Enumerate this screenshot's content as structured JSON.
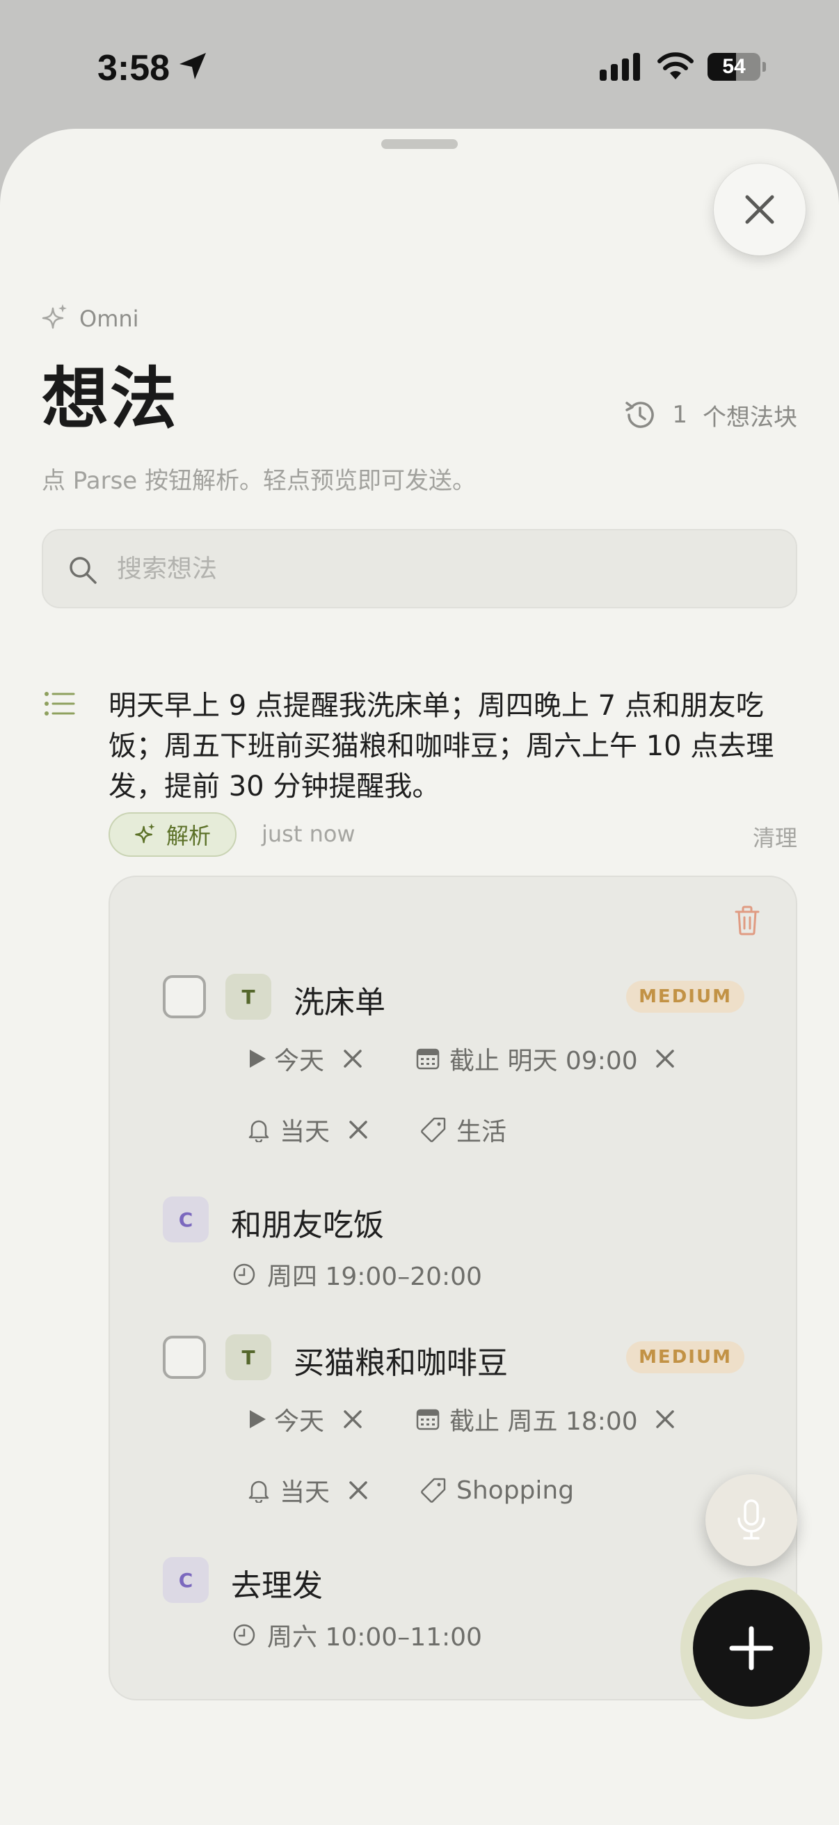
{
  "status_bar": {
    "time": "3:58",
    "battery": "54"
  },
  "header": {
    "app_label": "Omni",
    "title": "想法",
    "blocks_count": "1",
    "blocks_label": "个想法块",
    "hint": "点 Parse 按钮解析。轻点预览即可发送。"
  },
  "search": {
    "placeholder": "搜索想法"
  },
  "thought": {
    "text": "明天早上 9 点提醒我洗床单；周四晚上 7 点和朋友吃饭；周五下班前买猫粮和咖啡豆；周六上午 10 点去理发，提前 30 分钟提醒我。",
    "parse_label": "解析",
    "timestamp": "just now",
    "cleanup_label": "清理"
  },
  "parsed_items": [
    {
      "type": "T",
      "title": "洗床单",
      "priority": "MEDIUM",
      "start": "今天",
      "due": "截止 明天 09:00",
      "reminder": "当天",
      "tag": "生活"
    },
    {
      "type": "C",
      "title": "和朋友吃饭",
      "time": "周四 19:00–20:00"
    },
    {
      "type": "T",
      "title": "买猫粮和咖啡豆",
      "priority": "MEDIUM",
      "start": "今天",
      "due": "截止 周五 18:00",
      "reminder": "当天",
      "tag": "Shopping"
    },
    {
      "type": "C",
      "title": "去理发",
      "time": "周六 10:00–11:00"
    }
  ],
  "colors": {
    "accent_green": "#5c7128",
    "priority_bg": "#eedfc9",
    "priority_text": "#c29245",
    "event_badge": "#7b68be",
    "fab": "#141414"
  }
}
